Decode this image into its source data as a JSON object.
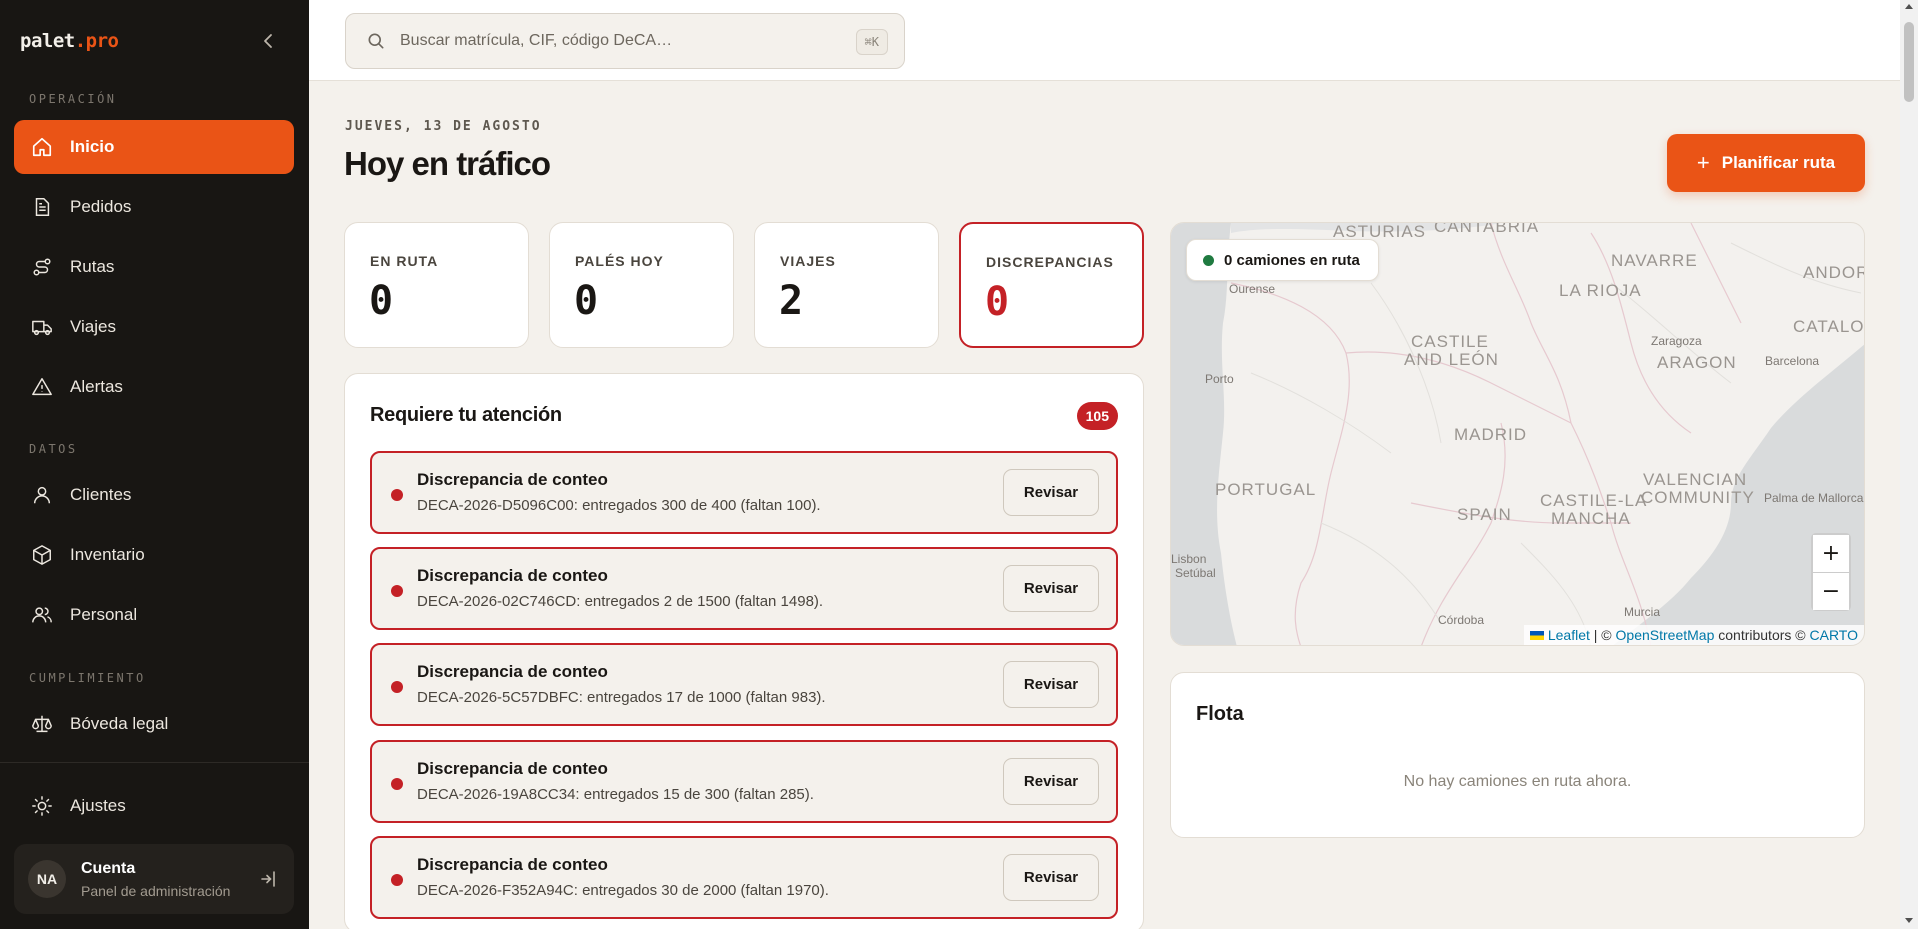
{
  "brand": {
    "name_main": "palet",
    "name_dot": ".pro"
  },
  "sidebar": {
    "sections": [
      {
        "label": "OPERACIÓN"
      },
      {
        "label": "DATOS"
      },
      {
        "label": "CUMPLIMIENTO"
      }
    ],
    "items": [
      {
        "label": "Inicio",
        "icon": "home-icon",
        "active": true
      },
      {
        "label": "Pedidos",
        "icon": "document-icon"
      },
      {
        "label": "Rutas",
        "icon": "route-icon"
      },
      {
        "label": "Viajes",
        "icon": "truck-icon"
      },
      {
        "label": "Alertas",
        "icon": "warning-icon"
      },
      {
        "label": "Clientes",
        "icon": "user-icon"
      },
      {
        "label": "Inventario",
        "icon": "box-icon"
      },
      {
        "label": "Personal",
        "icon": "users-icon"
      },
      {
        "label": "Bóveda legal",
        "icon": "scale-icon"
      },
      {
        "label": "Ajustes",
        "icon": "sun-icon"
      }
    ],
    "account": {
      "initials": "NA",
      "name": "Cuenta",
      "subtitle": "Panel de administración"
    }
  },
  "search": {
    "placeholder": "Buscar matrícula, CIF, código DeCA…",
    "shortcut": "⌘K"
  },
  "header": {
    "date": "JUEVES, 13 DE AGOSTO",
    "title": "Hoy en tráfico",
    "plan_button": "Planificar ruta"
  },
  "stats": [
    {
      "label": "EN RUTA",
      "value": "0"
    },
    {
      "label": "PALÉS HOY",
      "value": "0"
    },
    {
      "label": "VIAJES",
      "value": "2"
    },
    {
      "label": "DISCREPANCIAS",
      "value": "0"
    }
  ],
  "attention": {
    "title": "Requiere tu atención",
    "count": "105",
    "review_label": "Revisar",
    "items": [
      {
        "title": "Discrepancia de conteo",
        "description": "DECA-2026-D5096C00: entregados 300 de 400 (faltan 100)."
      },
      {
        "title": "Discrepancia de conteo",
        "description": "DECA-2026-02C746CD: entregados 2 de 1500 (faltan 1498)."
      },
      {
        "title": "Discrepancia de conteo",
        "description": "DECA-2026-5C57DBFC: entregados 17 de 1000 (faltan 983)."
      },
      {
        "title": "Discrepancia de conteo",
        "description": "DECA-2026-19A8CC34: entregados 15 de 300 (faltan 285)."
      },
      {
        "title": "Discrepancia de conteo",
        "description": "DECA-2026-F352A94C: entregados 30 de 2000 (faltan 1970)."
      }
    ]
  },
  "map": {
    "trucks_label": "0 camiones en ruta",
    "zoom_in": "+",
    "zoom_out": "−",
    "labels": {
      "asturias": "ASTURIAS",
      "cantabria": "CANTABRIA",
      "navarre": "NAVARRE",
      "andorra": "ANDORRA",
      "ourense": "Ourense",
      "la_rioja": "LA RIOJA",
      "castile_1": "CASTILE",
      "castile_2": "AND LEÓN",
      "zaragoza": "Zaragoza",
      "aragon": "ARAGON",
      "catalonia": "CATALONIA",
      "barcelona": "Barcelona",
      "porto": "Porto",
      "madrid": "MADRID",
      "portugal": "PORTUGAL",
      "valencian_1": "VALENCIAN",
      "valencian_2": "COMMUNITY",
      "castilla_1": "CASTILE-LA",
      "castilla_2": "MANCHA",
      "spain": "SPAIN",
      "palma": "Palma de Mallorca",
      "lisbon": "Lisbon",
      "setubal": "Setúbal",
      "murcia": "Murcia",
      "cordoba": "Córdoba"
    },
    "attribution": {
      "leaflet": "Leaflet",
      "sep1": " | © ",
      "osm": "OpenStreetMap",
      "mid": " contributors © ",
      "carto": "CARTO"
    }
  },
  "fleet": {
    "title": "Flota",
    "empty": "No hay camiones en ruta ahora."
  },
  "colors": {
    "accent": "#ea5416",
    "danger": "#c42126",
    "sidebar_bg": "#181613",
    "page_bg": "#f4f1ec",
    "live": "#1f7a40"
  }
}
